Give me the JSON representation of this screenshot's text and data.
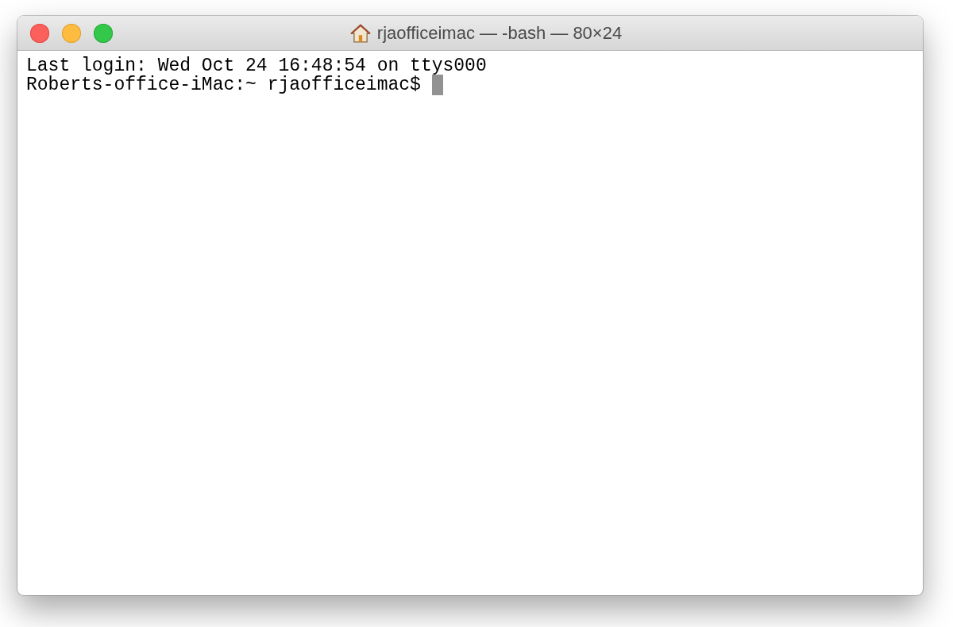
{
  "window": {
    "title": "rjaofficeimac — -bash — 80×24"
  },
  "terminal": {
    "lines": [
      "Last login: Wed Oct 24 16:48:54 on ttys000",
      "Roberts-office-iMac:~ rjaofficeimac$ "
    ]
  }
}
